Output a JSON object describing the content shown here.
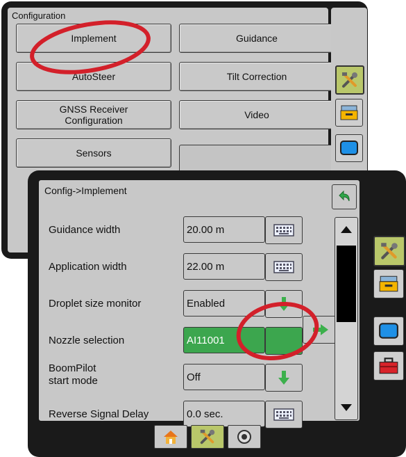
{
  "back": {
    "title": "Configuration",
    "buttons": {
      "implement": "Implement",
      "guidance": "Guidance",
      "autosteer": "AutoSteer",
      "tilt_correction": "Tilt Correction",
      "gnss_line1": "GNSS Receiver",
      "gnss_line2": "Configuration",
      "video": "Video",
      "sensors": "Sensors"
    }
  },
  "front": {
    "title": "Config->Implement",
    "rows": [
      {
        "label": "Guidance width",
        "value": "20.00 m"
      },
      {
        "label": "Application width",
        "value": "22.00 m"
      },
      {
        "label": "Droplet size monitor",
        "value": "Enabled"
      },
      {
        "label": "Nozzle selection",
        "value": "AI11001"
      },
      {
        "label_line1": "BoomPilot",
        "label_line2": "start mode",
        "value": "Off"
      },
      {
        "label": "Reverse Signal Delay",
        "value": "0.0 sec."
      }
    ]
  },
  "colors": {
    "panel_frame": "#1a1a1a",
    "panel_bg": "#c8c8c8",
    "active_green": "#3ca64e",
    "highlight_tab": "#b9c76a",
    "annotation_red": "#d3202a"
  },
  "icons": [
    "tools-icon",
    "folder-icon",
    "screen-icon",
    "toolbox-icon",
    "keyboard-icon",
    "down-arrow-icon",
    "right-arrow-icon",
    "undo-icon",
    "home-icon",
    "camera-icon",
    "scroll-up-icon",
    "scroll-down-icon"
  ]
}
